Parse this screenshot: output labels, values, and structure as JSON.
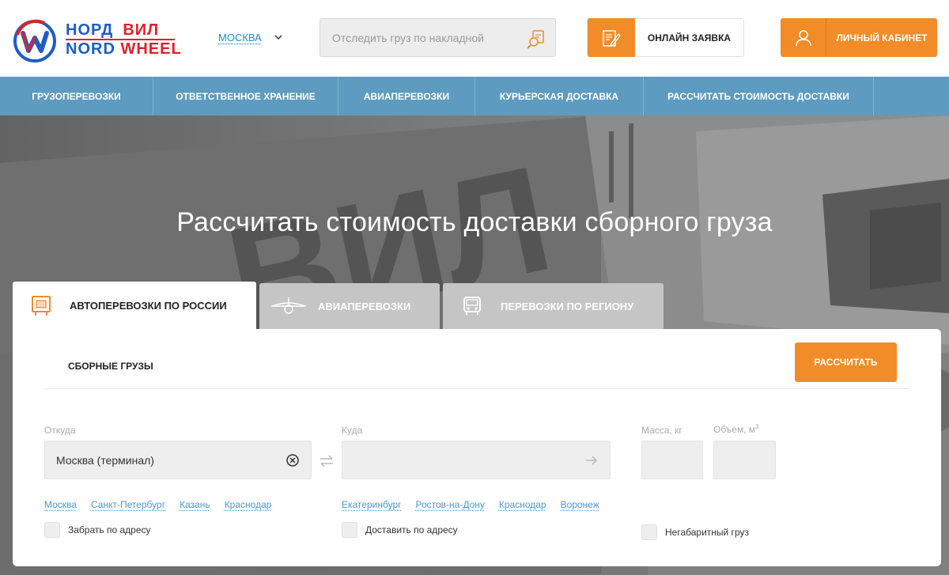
{
  "header": {
    "logo": {
      "line1_a": "НОРД",
      "line1_b": "ВИЛ",
      "line2_a": "NORD",
      "line2_b": "WHEEL"
    },
    "city": "МОСКВА",
    "track": {
      "placeholder": "Отследить груз по накладной"
    },
    "online_order_label": "ОНЛАЙН ЗАЯВКА",
    "cabinet_label": "ЛИЧНЫЙ КАБИНЕТ"
  },
  "nav": {
    "items": [
      {
        "label": "ГРУЗОПЕРЕВОЗКИ"
      },
      {
        "label": "ОТВЕТСТВЕННОЕ ХРАНЕНИЕ"
      },
      {
        "label": "АВИАПЕРЕВОЗКИ"
      },
      {
        "label": "КУРЬЕРСКАЯ ДОСТАВКА"
      },
      {
        "label": "РАССЧИТАТЬ СТОИМОСТЬ ДОСТАВКИ"
      }
    ]
  },
  "hero": {
    "title": "Рассчитать стоимость доставки сборного груза",
    "truck_text": "ВИЛ"
  },
  "tabs": [
    {
      "label": "АВТОПЕРЕВОЗКИ ПО РОССИИ",
      "icon": "truck-cargo-icon",
      "active": true
    },
    {
      "label": "АВИАПЕРЕВОЗКИ",
      "icon": "airplane-icon",
      "active": false
    },
    {
      "label": "ПЕРЕВОЗКИ ПО РЕГИОНУ",
      "icon": "bus-icon",
      "active": false
    }
  ],
  "form": {
    "subtab": "СБОРНЫЕ ГРУЗЫ",
    "from": {
      "label": "Откуда",
      "value": "Москва (терминал)",
      "quick": [
        "Москва",
        "Санкт-Петербург",
        "Казань",
        "Краснодар"
      ],
      "checkbox": "Забрать по адресу"
    },
    "to": {
      "label": "Куда",
      "value": "",
      "quick": [
        "Екатеринбург",
        "Ростов-на-Дону",
        "Краснодар",
        "Воронеж"
      ],
      "checkbox": "Доставить по адресу"
    },
    "mass_label": "Масса, кг",
    "volume_label": "Объем, м",
    "volume_sup": "3",
    "oversize_label": "Негабаритный груз",
    "calc_button": "РАССЧИТАТЬ"
  },
  "colors": {
    "accent": "#f28c28",
    "nav": "#5d9bc0",
    "link": "#4a9ad0",
    "logo_blue": "#1e5cc4",
    "logo_red": "#e0202a"
  }
}
